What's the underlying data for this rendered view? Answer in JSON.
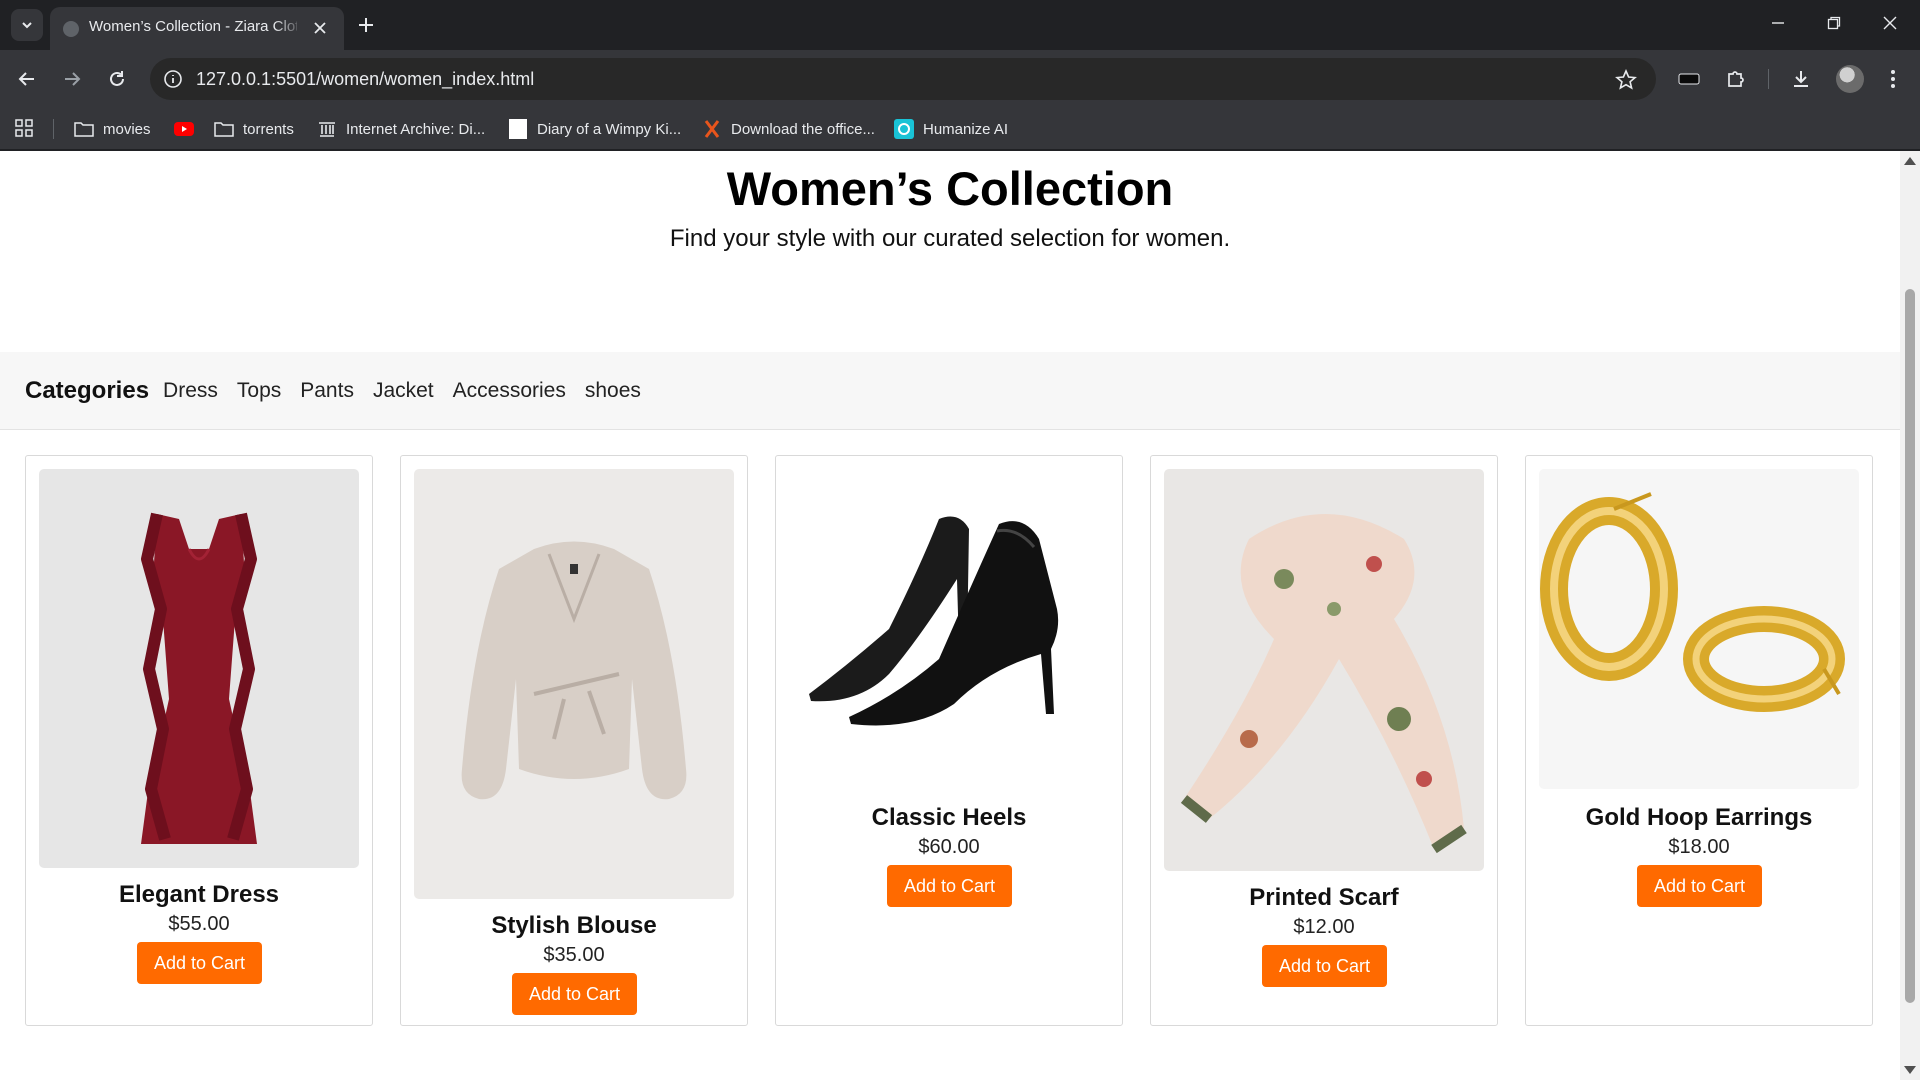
{
  "browser": {
    "tab_title": "Women’s Collection - Ziara Clothing",
    "url": "127.0.0.1:5501/women/women_index.html",
    "bookmarks": [
      {
        "label": "movies",
        "icon": "folder-icon"
      },
      {
        "label": "",
        "icon": "youtube-icon"
      },
      {
        "label": "torrents",
        "icon": "folder-icon"
      },
      {
        "label": "Internet Archive: Di...",
        "icon": "archive-icon"
      },
      {
        "label": "Diary of a Wimpy Ki...",
        "icon": "page-icon"
      },
      {
        "label": "Download the office...",
        "icon": "x-logo-icon"
      },
      {
        "label": "Humanize AI",
        "icon": "humanize-icon"
      }
    ]
  },
  "page": {
    "title": "Women’s Collection",
    "subtitle": "Find your style with our curated selection for women."
  },
  "categories": {
    "heading": "Categories",
    "items": [
      "Dress",
      "Tops",
      "Pants",
      "Jacket",
      "Accessories",
      "shoes"
    ]
  },
  "products": [
    {
      "name": "Elegant Dress",
      "price": "$55.00",
      "button": "Add to Cart",
      "image": "red-dress-image",
      "color": "#8a1726"
    },
    {
      "name": "Stylish Blouse",
      "price": "$35.00",
      "button": "Add to Cart",
      "image": "satin-blouse-image",
      "color": "#d8cfc7"
    },
    {
      "name": "Classic Heels",
      "price": "$60.00",
      "button": "Add to Cart",
      "image": "black-heels-image",
      "color": "#1b1b1b"
    },
    {
      "name": "Printed Scarf",
      "price": "$12.00",
      "button": "Add to Cart",
      "image": "floral-scarf-image",
      "color": "#efd9cc"
    },
    {
      "name": "Gold Hoop Earrings",
      "price": "$18.00",
      "button": "Add to Cart",
      "image": "gold-hoops-image",
      "color": "#d9a92a"
    }
  ],
  "colors": {
    "accent": "#ff6a00",
    "chrome_dark": "#202124",
    "chrome_mid": "#35363a"
  }
}
